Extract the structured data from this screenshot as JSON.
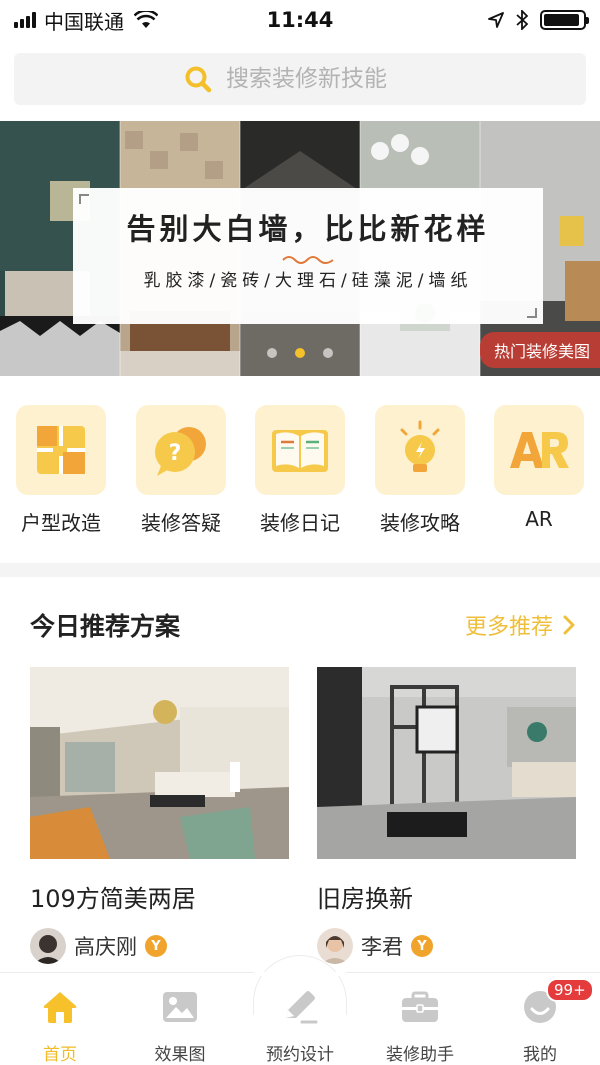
{
  "status_bar": {
    "carrier": "中国联通",
    "time": "11:44"
  },
  "search": {
    "placeholder": "搜索装修新技能"
  },
  "banner": {
    "title": "告别大白墙，比比新花样",
    "subtitle": "乳胶漆/瓷砖/大理石/硅藻泥/墙纸",
    "tag": "热门装修美图",
    "slide_count": 3,
    "active_slide": 2
  },
  "quick_menu": [
    {
      "label": "户型改造",
      "icon": "floorplan-icon"
    },
    {
      "label": "装修答疑",
      "icon": "question-bubble-icon"
    },
    {
      "label": "装修日记",
      "icon": "open-book-icon"
    },
    {
      "label": "装修攻略",
      "icon": "lightbulb-icon"
    },
    {
      "label": "AR",
      "icon": "ar-icon"
    }
  ],
  "recommend": {
    "title": "今日推荐方案",
    "more": "更多推荐",
    "cards": [
      {
        "title": "109方简美两居",
        "author": "高庆刚",
        "badge": "Y"
      },
      {
        "title": "旧房换新",
        "author": "李君",
        "badge": "Y"
      }
    ]
  },
  "tab_bar": {
    "tabs": [
      {
        "label": "首页",
        "icon": "home-icon",
        "active": true
      },
      {
        "label": "效果图",
        "icon": "image-icon"
      },
      {
        "label": "预约设计",
        "icon": "pen-icon"
      },
      {
        "label": "装修助手",
        "icon": "toolbox-icon"
      },
      {
        "label": "我的",
        "icon": "profile-icon",
        "badge": "99+"
      }
    ]
  },
  "colors": {
    "accent": "#f0bc2b",
    "icon_bg": "#fdf1cf",
    "badge_red": "#e43c3c",
    "tag_red": "#c43c32"
  }
}
